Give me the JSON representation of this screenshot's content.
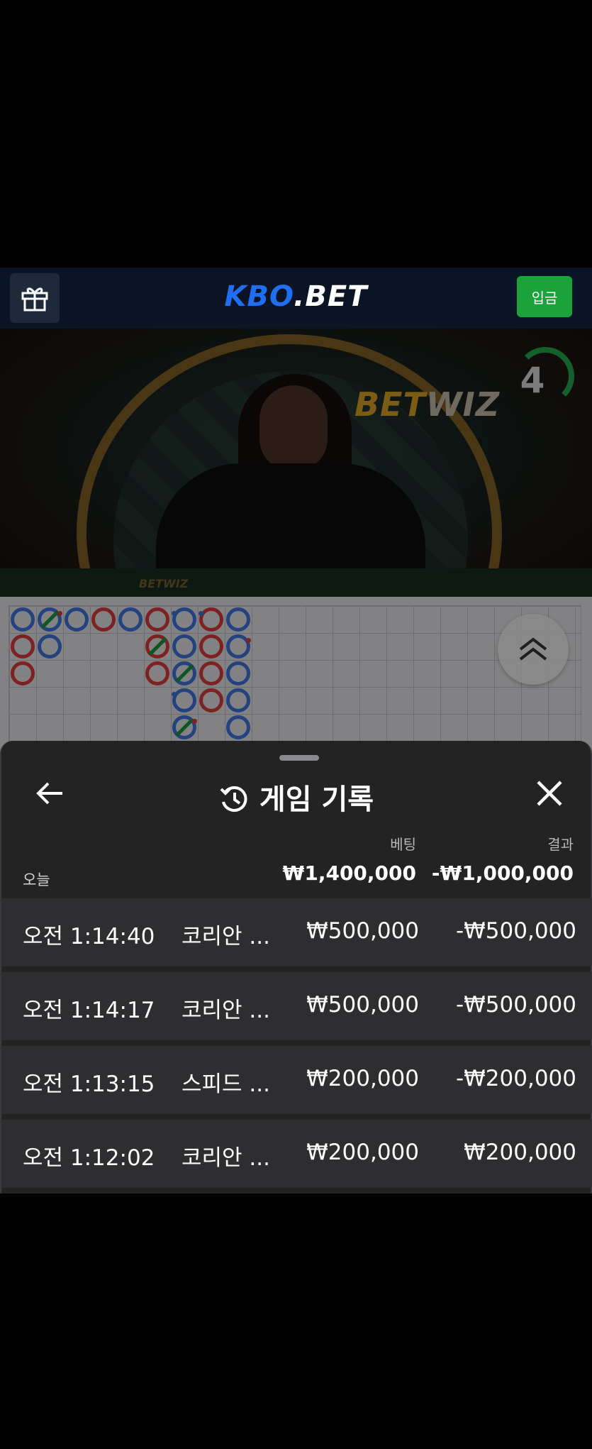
{
  "header": {
    "logo_prefix": "KBO",
    "logo_suffix": ".BET",
    "deposit_label": "입금"
  },
  "video": {
    "wall_brand_bet": "BET",
    "wall_brand_wiz": "WIZ",
    "table_brand": "BETWIZ",
    "timer_value": "4"
  },
  "roadmap": {
    "columns": [
      [
        "B",
        "R",
        "R"
      ],
      [
        "B",
        "B"
      ],
      [
        "B"
      ],
      [
        "R"
      ],
      [
        "B"
      ],
      [
        "R",
        "R",
        "R"
      ],
      [
        "B",
        "B",
        "B",
        "B",
        "B"
      ],
      [
        "R",
        "R",
        "R",
        "R"
      ],
      [
        "B",
        "B",
        "B",
        "B",
        "B"
      ]
    ],
    "colors": {
      "banker": "#d03a3a",
      "player": "#3b6fd3",
      "tie": "#1a8e3a"
    }
  },
  "sheet": {
    "title": "게임 기록",
    "col_bet": "베팅",
    "col_result": "결과",
    "summary_label": "오늘",
    "summary_bet": "₩1,400,000",
    "summary_result": "-₩1,000,000",
    "rows": [
      {
        "time": "오전 1:14:40",
        "game": "코리안 ...",
        "bet": "₩500,000",
        "result": "-₩500,000"
      },
      {
        "time": "오전 1:14:17",
        "game": "코리안 ...",
        "bet": "₩500,000",
        "result": "-₩500,000"
      },
      {
        "time": "오전 1:13:15",
        "game": "스피드 ...",
        "bet": "₩200,000",
        "result": "-₩200,000"
      },
      {
        "time": "오전 1:12:02",
        "game": "코리안 ...",
        "bet": "₩200,000",
        "result": "₩200,000"
      }
    ]
  }
}
